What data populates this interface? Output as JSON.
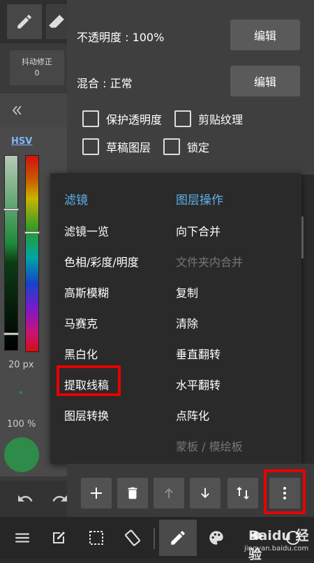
{
  "layer_panel": {
    "opacity_label": "不透明度 : 100%",
    "opacity_edit": "编辑",
    "blend_label": "混合 : 正常",
    "blend_edit": "编辑",
    "checkboxes": [
      {
        "label": "保护透明度",
        "checked": false
      },
      {
        "label": "剪贴纹理",
        "checked": false
      },
      {
        "label": "草稿图层",
        "checked": false
      },
      {
        "label": "锁定",
        "checked": false
      }
    ]
  },
  "left_panel": {
    "stabilizer_label": "抖动修正",
    "stabilizer_value": "0",
    "color_mode": "HSV",
    "brush_size": "20 px",
    "brush_opacity": "100 %",
    "current_color": "#2e8b4a"
  },
  "menu": {
    "filter_header": "滤镜",
    "layer_header": "图层操作",
    "filter_items": [
      "滤镜一览",
      "色相/彩度/明度",
      "高斯模糊",
      "马赛克",
      "黑白化",
      "提取线稿",
      "图层转换"
    ],
    "layer_items": [
      {
        "label": "向下合并",
        "enabled": true
      },
      {
        "label": "文件夹内合并",
        "enabled": false
      },
      {
        "label": "复制",
        "enabled": true
      },
      {
        "label": "清除",
        "enabled": true
      },
      {
        "label": "垂直翻转",
        "enabled": true
      },
      {
        "label": "水平翻转",
        "enabled": true
      },
      {
        "label": "点阵化",
        "enabled": true
      },
      {
        "label": "蒙板 / 模绘板",
        "enabled": false
      }
    ]
  },
  "watermark": {
    "text": "Baidu 经验",
    "sub": "jingyan.baidu.com"
  },
  "colors": {
    "accent": "#5fb0ea",
    "highlight": "#e80000",
    "panel": "#3f3f3f",
    "menu_bg": "#2a2a2a"
  }
}
